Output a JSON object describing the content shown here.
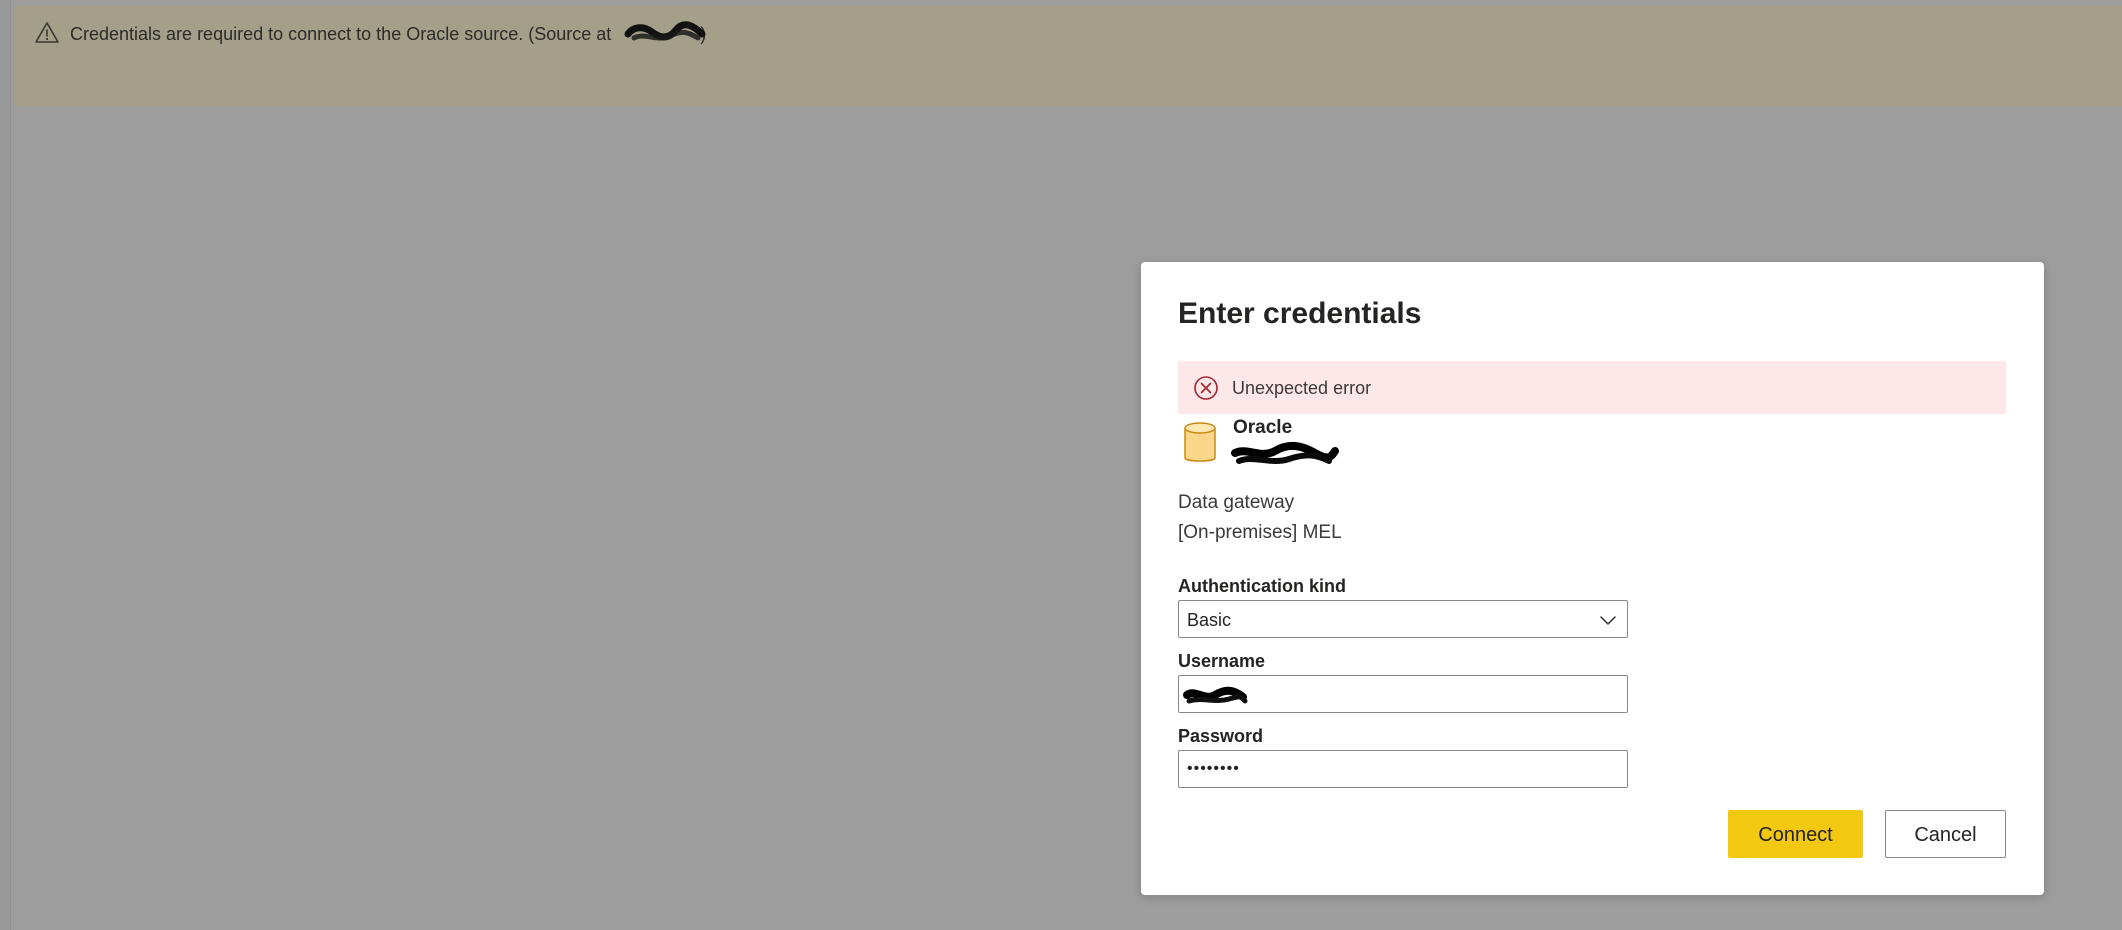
{
  "banner": {
    "message": "Credentials are required to connect to the Oracle source. (Source at ",
    "message_end": ")",
    "icon": "warning-triangle-icon"
  },
  "dialog": {
    "title": "Enter credentials",
    "error": {
      "text": "Unexpected error",
      "icon": "error-circle-icon",
      "color": "#a4262c",
      "background": "#fde7e9"
    },
    "source": {
      "type": "Oracle",
      "icon": "database-icon"
    },
    "gateway": {
      "label": "Data gateway",
      "value": "[On-premises] MEL"
    },
    "auth_kind": {
      "label": "Authentication kind",
      "value": "Basic"
    },
    "username": {
      "label": "Username"
    },
    "password": {
      "label": "Password",
      "value": "••••••••"
    },
    "buttons": {
      "connect": "Connect",
      "cancel": "Cancel"
    }
  },
  "colors": {
    "accent": "#f2c811",
    "overlay": "#9d9d9d",
    "warning_bar": "#a39f88"
  }
}
